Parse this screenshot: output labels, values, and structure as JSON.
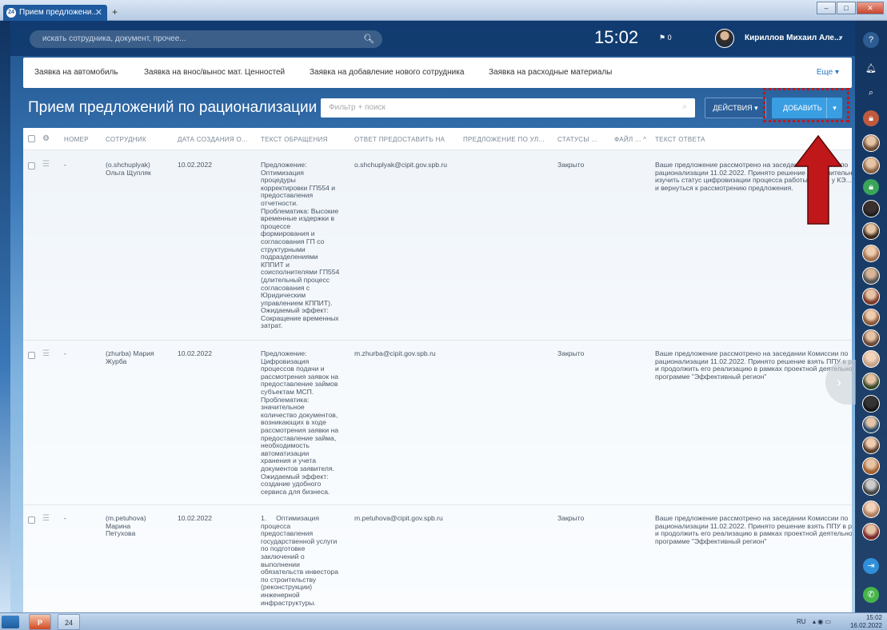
{
  "browser": {
    "tab_title": "Прием предложени...",
    "tab_close": "✕",
    "new_tab": "+",
    "favicon": "24"
  },
  "header": {
    "search_placeholder": "искать сотрудника, документ, прочее...",
    "clock": "15:02",
    "flag_count": "0",
    "user_name": "Кириллов Михаил Але..."
  },
  "quick_tabs": [
    "Заявка на автомобиль",
    "Заявка на внос/вынос мат. Ценностей",
    "Заявка на добавление нового сотрудника",
    "Заявка на расходные материалы"
  ],
  "quick_more": "Еще",
  "page": {
    "title": "Прием предложений по рационализации",
    "filter_placeholder": "Фильтр + поиск",
    "actions_label": "ДЕЙСТВИЯ",
    "add_label": "ДОБАВИТЬ"
  },
  "table": {
    "columns": {
      "number": "НОМЕР",
      "employee": "СОТРУДНИК",
      "created": "ДАТА СОЗДАНИЯ О...",
      "text": "ТЕКСТ ОБРАЩЕНИЯ",
      "reply_to": "ОТВЕТ ПРЕДОСТАВИТЬ НА",
      "proposal": "ПРЕДЛОЖЕНИЕ ПО УЛ...",
      "status": "СТАТУСЫ ...",
      "file": "ФАЙЛ ...",
      "answer": "ТЕКСТ ОТВЕТА"
    },
    "rows": [
      {
        "number": "-",
        "employee": "(o.shchuplyak)\nОльга Щупляк",
        "created": "10.02.2022",
        "text": "Предложение:\nОптимизация\nпроцедуры\nкорректировки ГП554 и\nпредоставления\nотчетности.\nПроблематика: Высокие\nвременные издержки в\nпроцессе\nформирования и\nсогласования ГП со\nструктурными\nподразделениями\nКППИТ и\nсоисполнителями ГП554\n(длительный процесс\nсогласования с\nЮридическим\nуправлением КППИТ).\nОжидаемый эффект:\nСокращение временных\nзатрат.",
        "reply_to": "o.shchuplyak@cipit.gov.spb.ru",
        "status": "Закрыто",
        "answer": "Ваше предложение рассмотрено на заседании Комиссии по\nрационализации 11.02.2022. Принято решение дополнительно\nизучить статус цифровизации процесса работы ГП554 у КЭ...\nи вернуться к рассмотрению предложения."
      },
      {
        "number": "-",
        "employee": "(zhurba) Мария\nЖурба",
        "created": "10.02.2022",
        "text": "Предложение:\nЦифровизация\nпроцессов подачи и\nрассмотрения заявок на\nпредоставление займов\nсубъектам МСП.\nПроблематика:\nзначительное\nколичество документов,\nвозникающих в ходе\nрассмотрения заявки на\nпредоставление займа,\nнеобходимость\nавтоматизации\nхранения и учета\nдокументов заявителя.\nОжидаемый эффект:\nсоздание удобного\nсервиса для бизнеса.",
        "reply_to": "m.zhurba@cipit.gov.spb.ru",
        "status": "Закрыто",
        "answer": "Ваше предложение рассмотрено на заседании Комиссии по\nрационализации 11.02.2022. Принято решение взять ППУ в ра...\nи продолжить его реализацию в рамках проектной деятельно...\nпрограмме \"Эффективный регион\""
      },
      {
        "number": "-",
        "employee": "(m.petuhova)\nМарина\nПетухова",
        "created": "10.02.2022",
        "text": "1.     Оптимизация\nпроцесса\nпредоставления\nгосударственной услуги\nпо подготовке\nзаключений о\nвыполнении\nобязательств инвестора\nпо строительству\n(реконструкции)\nинженерной\nинфраструктуры.",
        "reply_to": "m.petuhova@cipit.gov.spb.ru",
        "status": "Закрыто",
        "answer": "Ваше предложение рассмотрено на заседании Комиссии по\nрационализации 11.02.2022. Принято решение взять ППУ в ра...\nи продолжить его реализацию в рамках проектной деятельно...\nпрограмме \"Эффективный регион\""
      }
    ]
  },
  "taskbar": {
    "badge": "24",
    "lang": "RU",
    "time": "15:02",
    "date": "16.02.2022"
  },
  "colors": {
    "header_bg": "#103a6e",
    "add_button": "#3a9ee3",
    "annotation_red": "#c0171a"
  }
}
